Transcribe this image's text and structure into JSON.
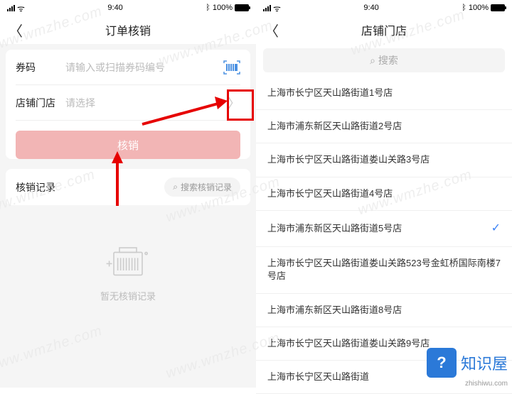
{
  "status": {
    "time": "9:40",
    "bt": "100%"
  },
  "left": {
    "title": "订单核销",
    "coupon_label": "券码",
    "coupon_placeholder": "请输入或扫描券码编号",
    "store_label": "店铺门店",
    "store_placeholder": "请选择",
    "submit": "核销",
    "records_label": "核销记录",
    "records_search": "搜索核销记录",
    "empty": "暂无核销记录"
  },
  "right": {
    "title": "店铺门店",
    "search": "搜索",
    "items": [
      {
        "name": "上海市长宁区天山路街道1号店",
        "selected": false
      },
      {
        "name": "上海市浦东新区天山路街道2号店",
        "selected": false
      },
      {
        "name": "上海市长宁区天山路街道娄山关路3号店",
        "selected": false
      },
      {
        "name": "上海市长宁区天山路街道4号店",
        "selected": false
      },
      {
        "name": "上海市浦东新区天山路街道5号店",
        "selected": true
      },
      {
        "name": "上海市长宁区天山路街道娄山关路523号金虹桥国际南楼7号店",
        "selected": false
      },
      {
        "name": "上海市浦东新区天山路街道8号店",
        "selected": false
      },
      {
        "name": "上海市长宁区天山路街道娄山关路9号店",
        "selected": false
      },
      {
        "name": "上海市长宁区天山路街道",
        "selected": false
      }
    ]
  },
  "watermark": "www.wmzhe.com",
  "brand": {
    "name": "知识屋",
    "url": "zhishiwu.com",
    "icon": "?"
  }
}
